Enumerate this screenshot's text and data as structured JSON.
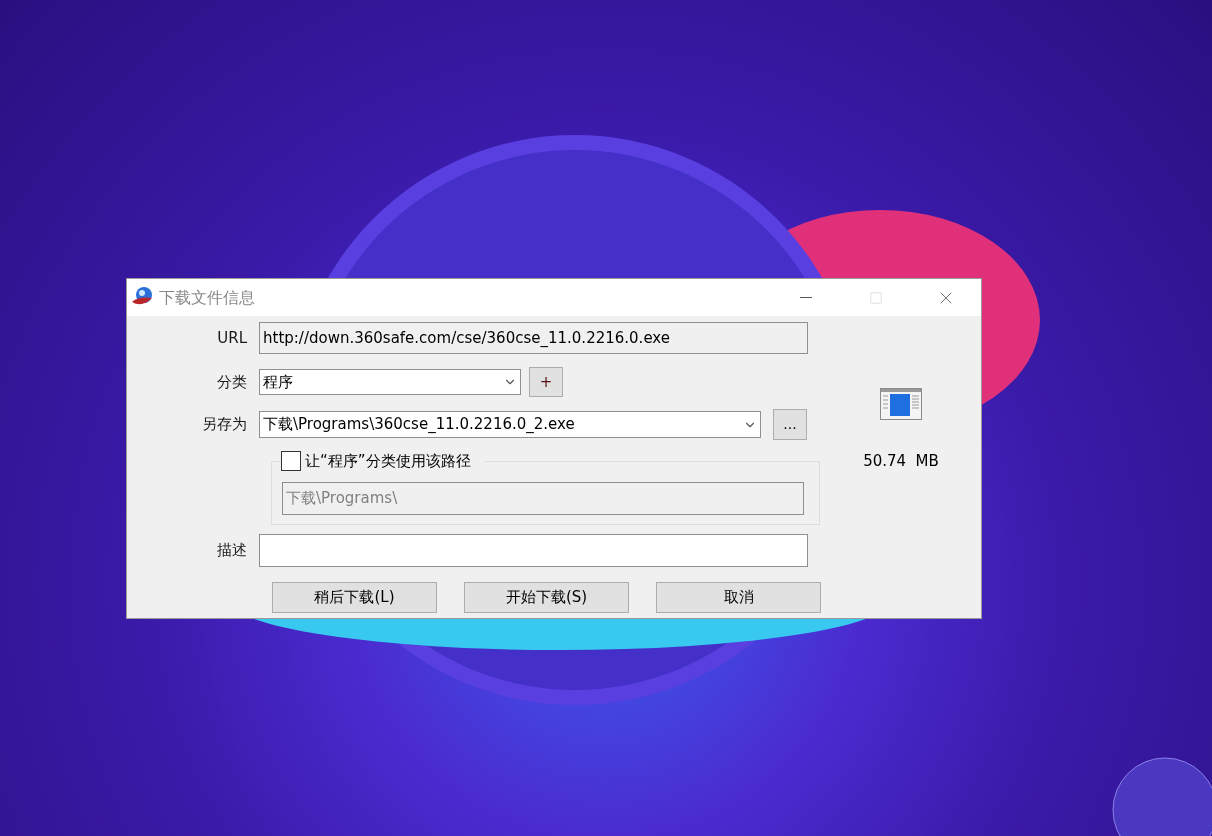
{
  "window": {
    "title": "下载文件信息"
  },
  "url": {
    "label": "URL",
    "value": "http://down.360safe.com/cse/360cse_11.0.2216.0.exe"
  },
  "category": {
    "label": "分类",
    "value": "程序",
    "add_button": "+"
  },
  "save_as": {
    "label": "另存为",
    "value": "下载\\Programs\\360cse_11.0.2216.0_2.exe",
    "browse_button": "..."
  },
  "use_path": {
    "label": "让“程序”分类使用该路径",
    "checked": false,
    "path": "下载\\Programs\\",
    "disabled": true
  },
  "description": {
    "label": "描述"
  },
  "file_size": "50.74  MB",
  "buttons": [
    {
      "label": "稍后下载(L)",
      "default": false
    },
    {
      "label": "开始下载(S)",
      "default": false
    },
    {
      "label": "取消",
      "default": false
    }
  ]
}
